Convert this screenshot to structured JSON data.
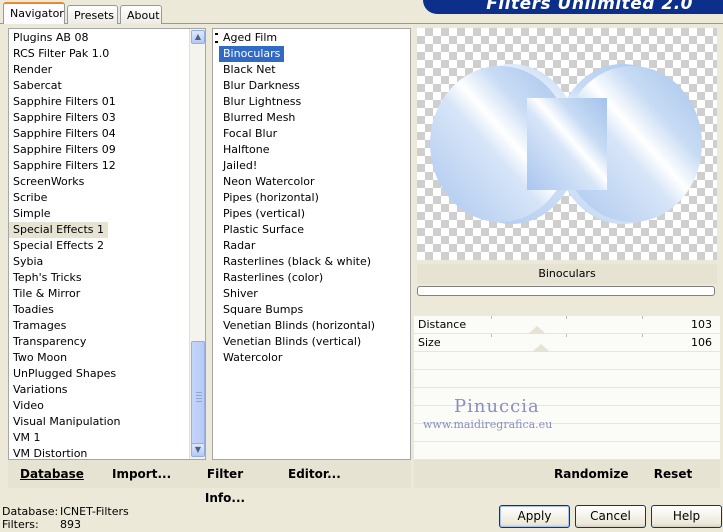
{
  "tabs": [
    {
      "label": "Navigator",
      "active": true
    },
    {
      "label": "Presets",
      "active": false
    },
    {
      "label": "About",
      "active": false
    }
  ],
  "brand": {
    "text": "Filters Unlimited 2.0"
  },
  "categories": [
    "Plugins AB 08",
    "RCS Filter Pak 1.0",
    "Render",
    "Sabercat",
    "Sapphire Filters 01",
    "Sapphire Filters 03",
    "Sapphire Filters 04",
    "Sapphire Filters 09",
    "Sapphire Filters 12",
    "ScreenWorks",
    "Scribe",
    "Simple",
    "Special Effects 1",
    "Special Effects 2",
    "Sybia",
    "Teph's Tricks",
    "Tile & Mirror",
    "Toadies",
    "Tramages",
    "Transparency",
    "Two Moon",
    "UnPlugged Shapes",
    "Variations",
    "Video",
    "Visual Manipulation",
    "VM 1",
    "VM Distortion"
  ],
  "selected_category": "Special Effects 1",
  "filters": [
    "Aged Film",
    "Binoculars",
    "Black Net",
    "Blur Darkness",
    "Blur Lightness",
    "Blurred Mesh",
    "Focal Blur",
    "Halftone",
    "Jailed!",
    "Neon Watercolor",
    "Pipes (horizontal)",
    "Pipes (vertical)",
    "Plastic Surface",
    "Radar",
    "Rasterlines (black & white)",
    "Rasterlines (color)",
    "Shiver",
    "Square Bumps",
    "Venetian Blinds (horizontal)",
    "Venetian Blinds (vertical)",
    "Watercolor"
  ],
  "selected_filter": "Binoculars",
  "current_filter_name": "Binoculars",
  "params": [
    {
      "label": "Distance",
      "value": "103"
    },
    {
      "label": "Size",
      "value": "106"
    }
  ],
  "left_buttons": {
    "database": "Database",
    "import": "Import...",
    "filter_info": "Filter Info...",
    "editor": "Editor..."
  },
  "right_buttons": {
    "randomize": "Randomize",
    "reset": "Reset"
  },
  "status": {
    "database_label": "Database:",
    "database_value": "ICNET-Filters",
    "filters_label": "Filters:",
    "filters_value": "893"
  },
  "dialog_buttons": {
    "apply": "Apply",
    "cancel": "Cancel",
    "help": "Help"
  },
  "watermark": {
    "name": "Pinuccia",
    "url": "www.maidiregrafica.eu"
  },
  "colors": {
    "selection": "#316ac5",
    "brand_bg": "#0b2f8a"
  }
}
